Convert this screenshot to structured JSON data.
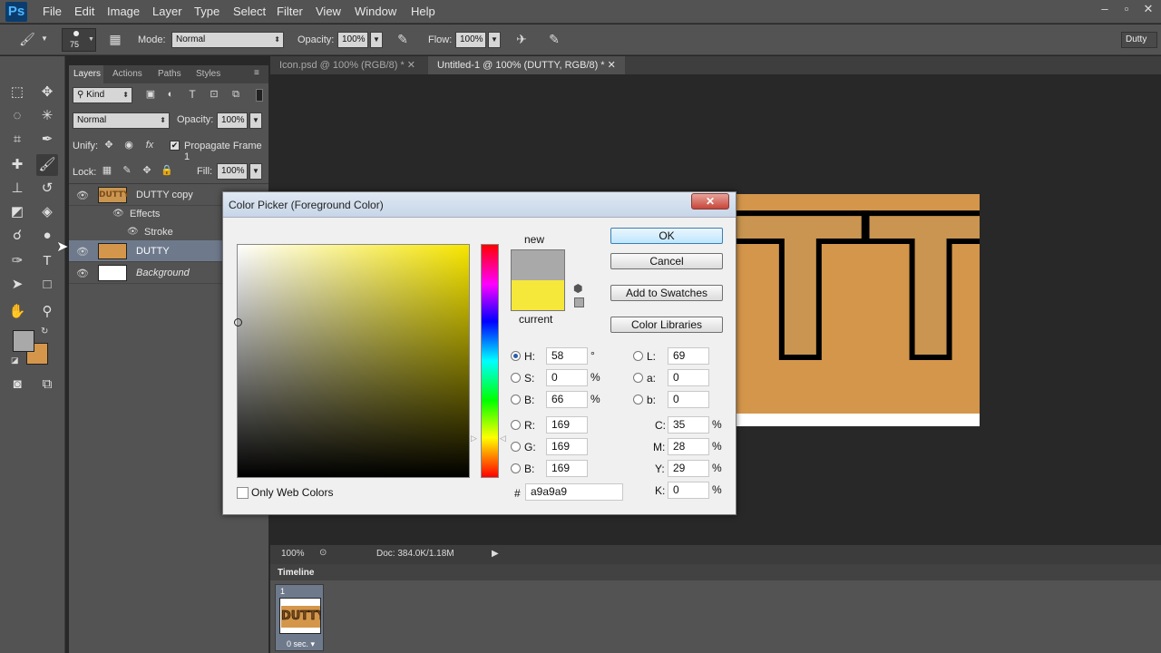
{
  "app": {
    "logo": "Ps"
  },
  "menu": [
    "File",
    "Edit",
    "Image",
    "Layer",
    "Type",
    "Select",
    "Filter",
    "View",
    "Window",
    "Help"
  ],
  "options_bar": {
    "brush_size": "75",
    "mode_label": "Mode:",
    "mode_value": "Normal",
    "opacity_label": "Opacity:",
    "opacity_value": "100%",
    "flow_label": "Flow:",
    "flow_value": "100%",
    "workspace": "Dutty"
  },
  "layers_panel": {
    "tabs": [
      "Layers",
      "Actions",
      "Paths",
      "Styles"
    ],
    "filter_kind": "Kind",
    "blend_mode": "Normal",
    "opacity_label": "Opacity:",
    "opacity_value": "100%",
    "unify_label": "Unify:",
    "propagate_label": "Propagate Frame 1",
    "lock_label": "Lock:",
    "fill_label": "Fill:",
    "fill_value": "100%",
    "layers": {
      "dutty_copy": "DUTTY copy",
      "effects": "Effects",
      "stroke": "Stroke",
      "dutty": "DUTTY",
      "background": "Background"
    }
  },
  "document_tabs": [
    "Icon.psd @ 100% (RGB/8) *",
    "Untitled-1 @ 100% (DUTTY, RGB/8) *"
  ],
  "canvas_text": "TTY",
  "status": {
    "zoom": "100%",
    "doc": "Doc: 384.0K/1.18M"
  },
  "timeline": {
    "title": "Timeline",
    "frame_number": "1",
    "frame_time": "0 sec.",
    "frame_thumb_text": "DUTTY"
  },
  "color_picker": {
    "title": "Color Picker (Foreground Color)",
    "new_label": "new",
    "current_label": "current",
    "new_color": "#a9a9a9",
    "current_color": "#f5e83a",
    "buttons": {
      "ok": "OK",
      "cancel": "Cancel",
      "add_swatches": "Add to Swatches",
      "color_libraries": "Color Libraries"
    },
    "only_web_colors": "Only Web Colors",
    "hsb": {
      "h_label": "H:",
      "h": "58",
      "h_unit": "°",
      "s_label": "S:",
      "s": "0",
      "s_unit": "%",
      "b_label": "B:",
      "b": "66",
      "b_unit": "%"
    },
    "rgb": {
      "r_label": "R:",
      "r": "169",
      "g_label": "G:",
      "g": "169",
      "b_label": "B:",
      "b": "169"
    },
    "lab": {
      "l_label": "L:",
      "l": "69",
      "a_label": "a:",
      "a": "0",
      "b_label": "b:",
      "b": "0"
    },
    "cmyk": {
      "c_label": "C:",
      "c": "35",
      "m_label": "M:",
      "m": "28",
      "y_label": "Y:",
      "y": "29",
      "k_label": "K:",
      "k": "0",
      "unit": "%"
    },
    "hex_label": "#",
    "hex": "a9a9a9"
  },
  "colors": {
    "foreground": "#a9a9a9",
    "background": "#d4964b"
  }
}
